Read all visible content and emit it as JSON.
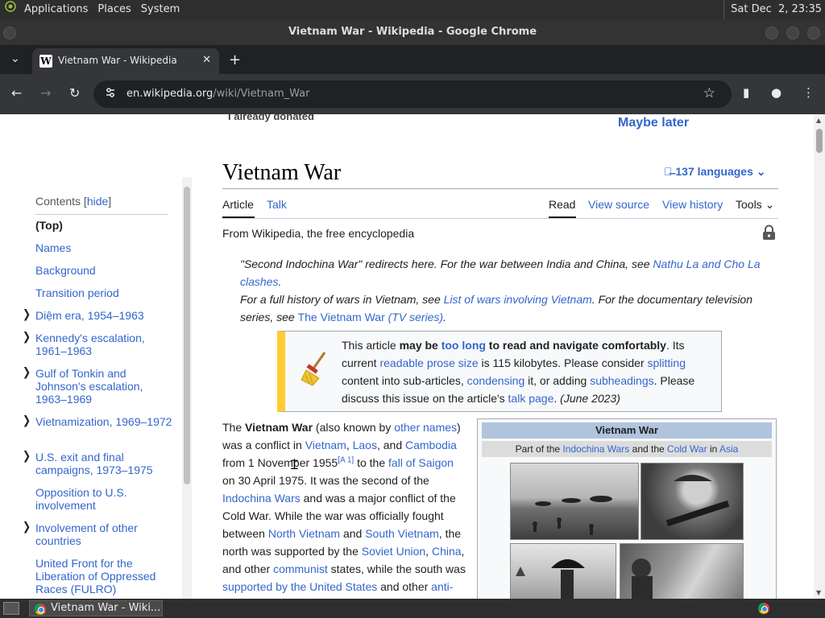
{
  "desktop": {
    "menus": [
      "Applications",
      "Places",
      "System"
    ],
    "clock": "Sat Dec  2, 23:35"
  },
  "window": {
    "title": "Vietnam War - Wikipedia - Google Chrome"
  },
  "tab": {
    "title": "Vietnam War - Wikipedia",
    "favicon": "W"
  },
  "address": {
    "domain": "en.wikipedia.org",
    "path": "/wiki/Vietnam_War"
  },
  "banner": {
    "donated": "I already donated",
    "maybe_later": "Maybe later"
  },
  "toc": {
    "heading": "Contents",
    "hide": "hide",
    "items": [
      "(Top)",
      "Names",
      "Background",
      "Transition period",
      "Diệm era, 1954–1963",
      "Kennedy's escalation, 1961–1963",
      "Gulf of Tonkin and Johnson's escalation, 1963–1969",
      "Vietnamization, 1969–1972",
      "U.S. exit and final campaigns, 1973–1975",
      "Opposition to U.S. involvement",
      "Involvement of other countries",
      "United Front for the Liberation of Oppressed Races (FULRO)"
    ]
  },
  "article": {
    "title": "Vietnam War",
    "languages": "137 languages",
    "tabs": {
      "article": "Article",
      "talk": "Talk",
      "read": "Read",
      "view_source": "View source",
      "view_history": "View history",
      "tools": "Tools"
    },
    "tagline": "From Wikipedia, the free encyclopedia",
    "hatnote1": {
      "a": "\"Second Indochina War\" redirects here. For the war between India and China, see ",
      "link": "Nathu La and Cho La clashes",
      "b": "."
    },
    "hatnote2": {
      "a": "For a full history of wars in Vietnam, see ",
      "link1": "List of wars involving Vietnam",
      "b": ". For the documentary television series, see ",
      "link2": "The Vietnam War",
      "link2_italic": " (TV series)",
      "c": "."
    },
    "ambox": {
      "t1": "This article ",
      "t2": "may be ",
      "t3": "too long",
      "t4": " to read and navigate comfortably",
      "t5": ". Its current ",
      "t6": "readable prose size",
      "t7": " is 115 kilobytes. Please consider ",
      "t8": "splitting",
      "t9": " content into sub-articles, ",
      "t10": "condensing",
      "t11": " it, or adding ",
      "t12": "subheadings",
      "t13": ". Please discuss this issue on the article's ",
      "t14": "talk page",
      "t15": ". ",
      "t16": "(June 2023)"
    },
    "lead": {
      "p1": "The ",
      "bold": "Vietnam War",
      "p2": " (also known by ",
      "l_other_names": "other names",
      "p3": ") was a conflict in ",
      "l_vietnam": "Vietnam",
      "p4": ", ",
      "l_laos": "Laos",
      "p5": ", and ",
      "l_cambodia": "Cambodia",
      "p6": " from 1 November 1955",
      "sup": "[A 1]",
      "p7": " to the ",
      "l_saigon": "fall of Saigon",
      "p8": " on 30 April 1975. It was the second of the ",
      "l_indochina": "Indochina Wars",
      "p9": " and was a major conflict of the Cold War. While the war was officially fought between ",
      "l_north": "North Vietnam",
      "p10": " and ",
      "l_south": "South Vietnam",
      "p11": ", the north was supported by the ",
      "l_soviet": "Soviet Union",
      "p12": ", ",
      "l_china": "China",
      "p13": ", and other ",
      "l_communist": "communist",
      "p14": " states, while the south was ",
      "l_us": "supported by the United States",
      "p15": " and other ",
      "l_anti": "anti-"
    },
    "infobox": {
      "title": "Vietnam War",
      "s1": "Part of the ",
      "l1": "Indochina Wars",
      "s2": " and the ",
      "l2": "Cold War",
      "s3": " in ",
      "l3": "Asia"
    }
  },
  "taskbar": {
    "task": "Vietnam War - Wiki..."
  }
}
